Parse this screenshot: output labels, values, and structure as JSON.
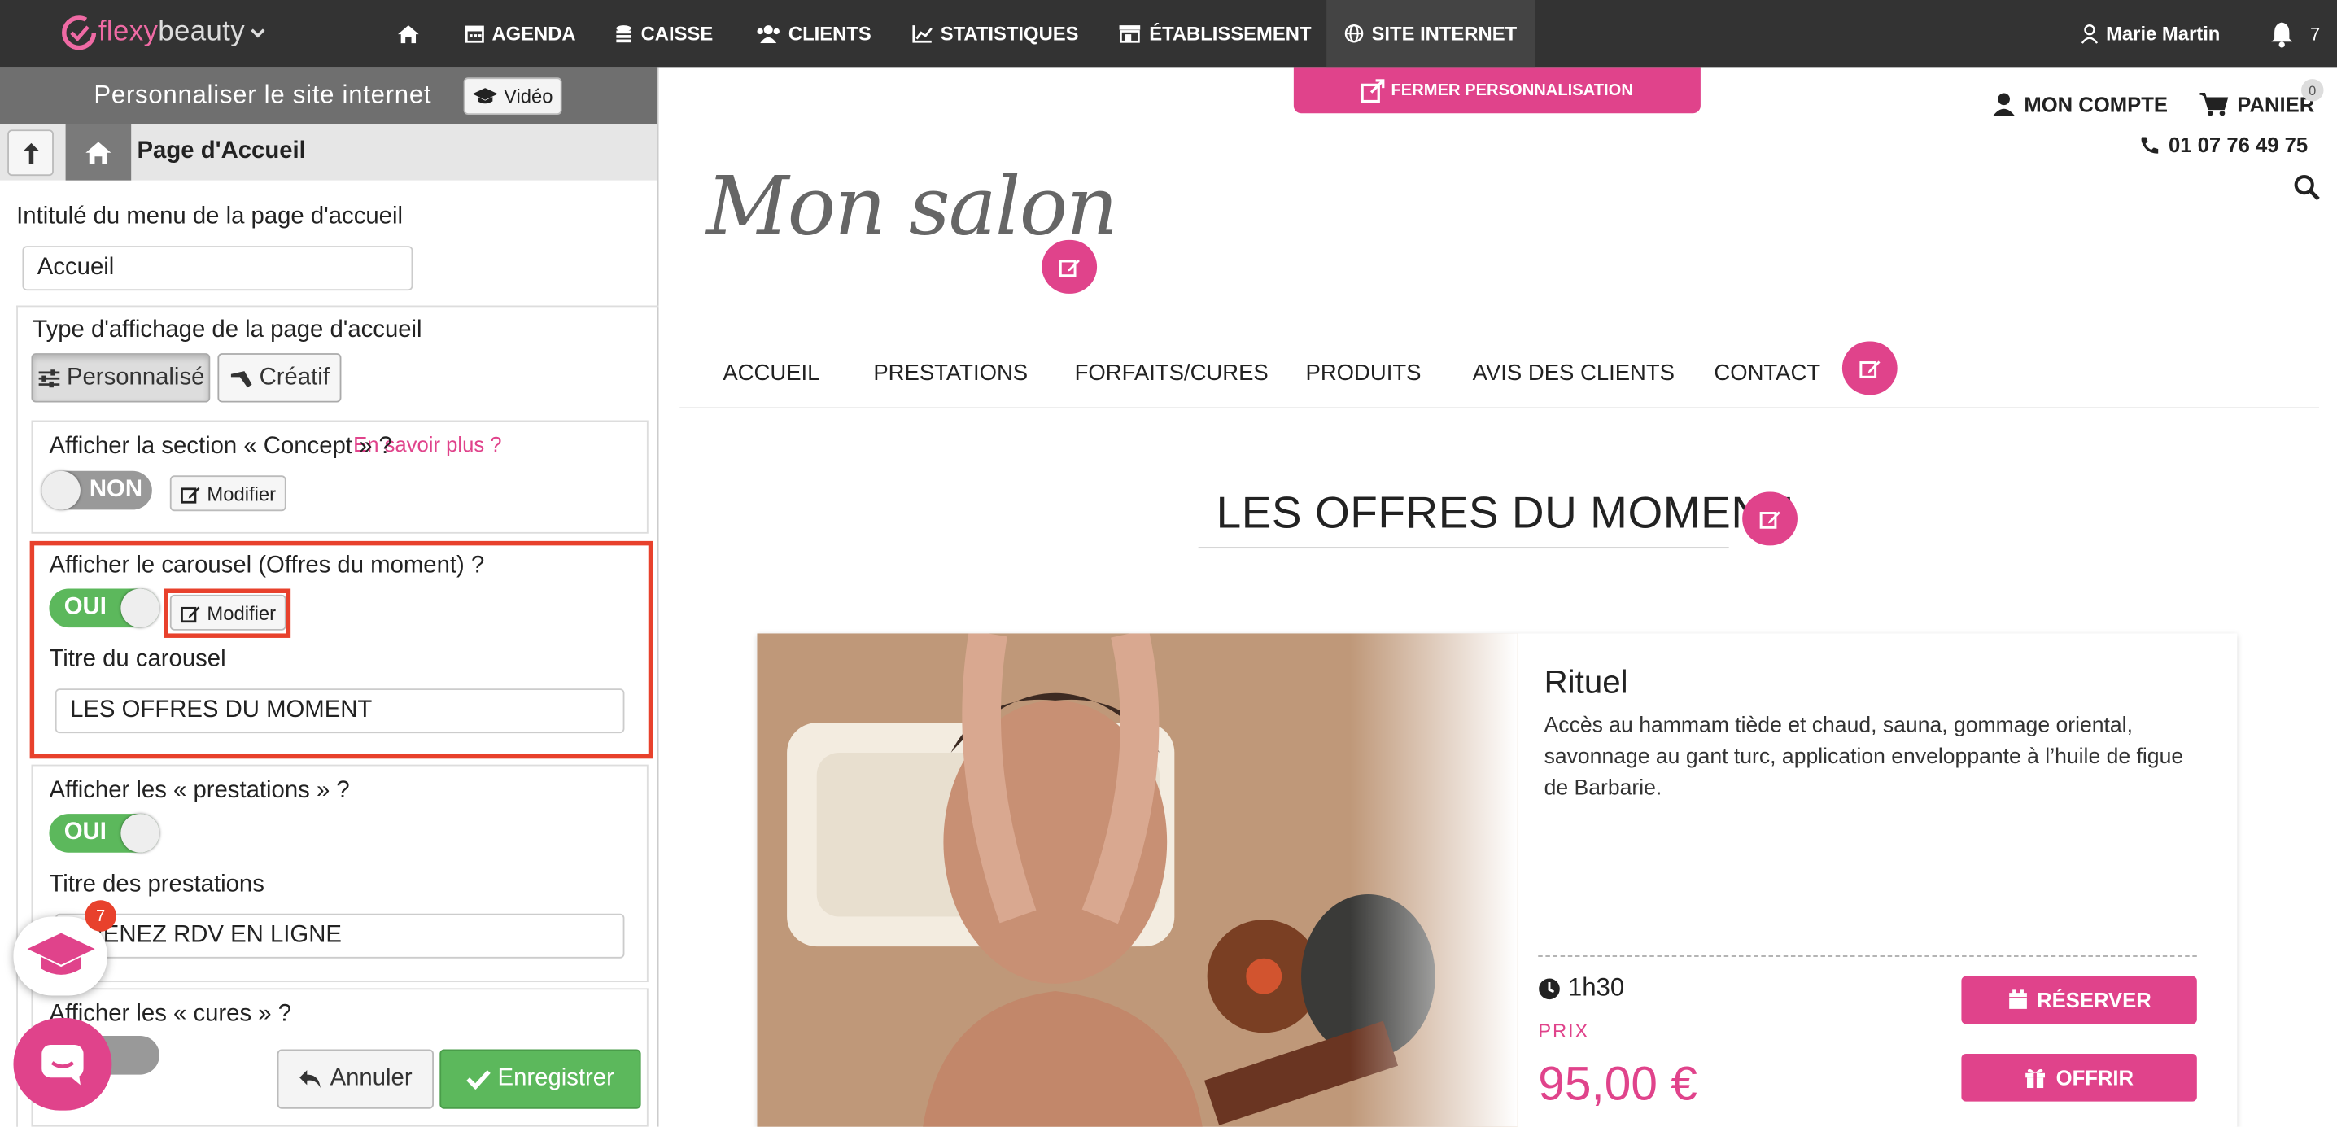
{
  "brand": {
    "name_part1": "flexy",
    "name_part2": "beauty"
  },
  "topnav": {
    "items": [
      {
        "label": "AGENDA",
        "icon": "calendar-icon"
      },
      {
        "label": "CAISSE",
        "icon": "coins-icon"
      },
      {
        "label": "CLIENTS",
        "icon": "users-icon"
      },
      {
        "label": "STATISTIQUES",
        "icon": "chart-icon"
      },
      {
        "label": "ÉTABLISSEMENT",
        "icon": "store-icon"
      },
      {
        "label": "SITE INTERNET",
        "icon": "globe-icon",
        "active": true
      }
    ],
    "user": "Marie Martin",
    "notif_count": "7"
  },
  "panel": {
    "title": "Personnaliser le site internet",
    "video_label": "Vidéo",
    "page_title": "Page d'Accueil",
    "menu_label": "Intitulé du menu de la page d'accueil",
    "menu_value": "Accueil",
    "display_type_label": "Type d'affichage de la page d'accueil",
    "btn_personnalise": "Personnalisé",
    "btn_creatif": "Créatif",
    "learn_more": "En savoir plus ?",
    "concept_label": "Afficher la section « Concept » ?",
    "concept_toggle": "NON",
    "modifier": "Modifier",
    "carousel_label": "Afficher le carousel (Offres du moment) ?",
    "carousel_toggle": "OUI",
    "carousel_title_label": "Titre du carousel",
    "carousel_title_value": "LES OFFRES DU MOMENT",
    "prestations_label": "Afficher les « prestations » ?",
    "prestations_toggle": "OUI",
    "prestations_title_label": "Titre des prestations",
    "prestations_title_value": "PRENEZ RDV EN LIGNE",
    "cures_label": "Afficher les « cures » ?",
    "cancel": "Annuler",
    "save": "Enregistrer",
    "tutorial_badge": "7"
  },
  "site": {
    "close_customization": "FERMER PERSONNALISATION",
    "account": "MON COMPTE",
    "cart": "PANIER",
    "cart_count": "0",
    "phone": "01 07 76 49 75",
    "logo_text": "Mon salon",
    "nav": [
      "ACCUEIL",
      "PRESTATIONS",
      "FORFAITS/CURES",
      "PRODUITS",
      "AVIS DES CLIENTS",
      "CONTACT"
    ],
    "section_title": "LES OFFRES DU MOMENT",
    "offer": {
      "title": "Rituel",
      "description": "Accès au hammam tiède et chaud, sauna, gommage oriental, savonnage au gant turc, application enveloppante à l’huile de figue de Barbarie.",
      "duration": "1h30",
      "price_label": "PRIX",
      "price": "95,00 €",
      "reserve": "RÉSERVER",
      "offer_btn": "OFFRIR"
    }
  },
  "colors": {
    "accent": "#e0438b",
    "topbar": "#333333",
    "toggle_on": "#5cb85c",
    "highlight": "#e8412c"
  }
}
